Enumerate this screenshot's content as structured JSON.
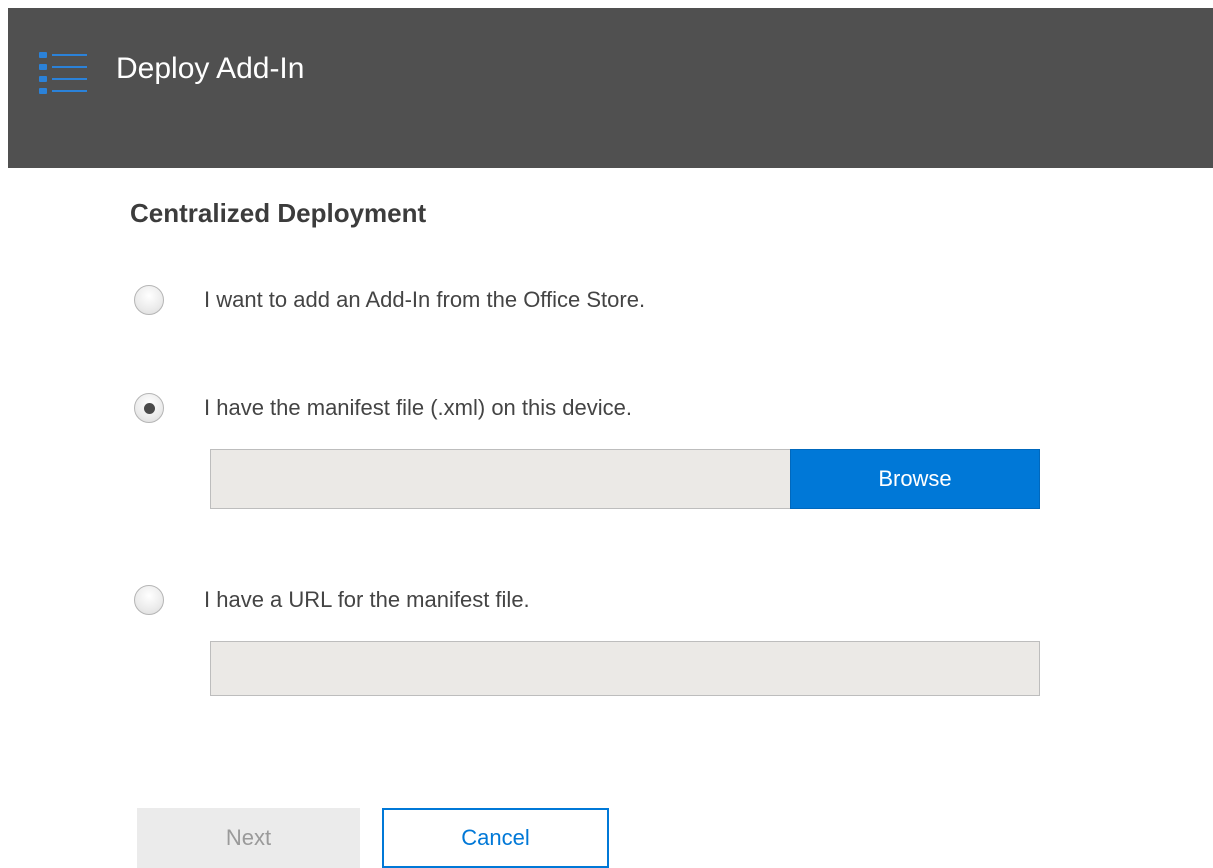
{
  "header": {
    "title": "Deploy Add-In",
    "icon": "list-icon",
    "accent_color": "#0078d7",
    "background_color": "#505050"
  },
  "section": {
    "title": "Centralized Deployment"
  },
  "options": [
    {
      "label": "I want to add an Add-In from the Office Store.",
      "checked": false
    },
    {
      "label": "I have the manifest file (.xml) on this device.",
      "checked": true
    },
    {
      "label": "I have a URL for the manifest file.",
      "checked": false
    }
  ],
  "file_input": {
    "value": "",
    "browse_label": "Browse"
  },
  "url_input": {
    "value": ""
  },
  "buttons": {
    "next_label": "Next",
    "next_enabled": false,
    "cancel_label": "Cancel"
  }
}
